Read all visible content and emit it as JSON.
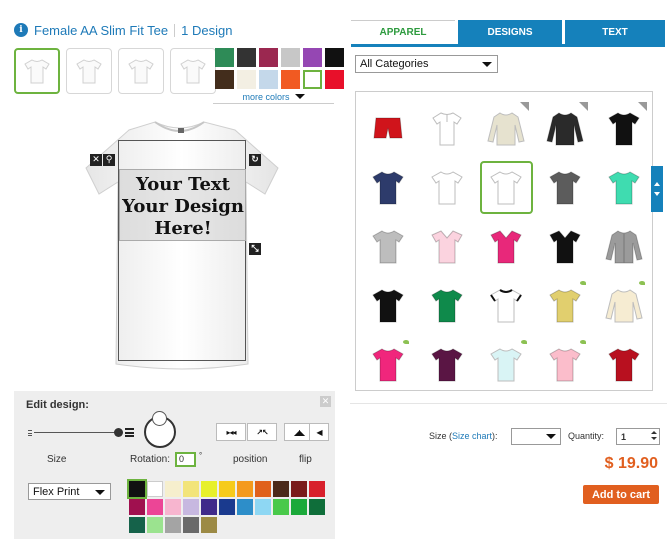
{
  "product": {
    "name": "Female AA Slim Fit Tee",
    "designs": "1 Design",
    "info_icon": "i"
  },
  "views": [
    {
      "name": "front-view",
      "selected": true
    },
    {
      "name": "back-view",
      "selected": false
    },
    {
      "name": "left-view",
      "selected": false
    },
    {
      "name": "right-view",
      "selected": false
    }
  ],
  "shirt_colors": [
    "#2e8b57",
    "#333333",
    "#9b2850",
    "#c7c7c7",
    "#9547b3",
    "#111111",
    "#432d1c",
    "#f3efe3",
    "#c4d8ea",
    "#f15a22",
    "#ffffff",
    "#e8102a"
  ],
  "selected_shirt_color": 10,
  "more_colors_label": "more colors",
  "design_text": "Your Text\nYour Design\nHere!",
  "edit": {
    "title": "Edit design:",
    "close": "✕",
    "size_label": "Size",
    "rotation_label": "Rotation:",
    "rotation_value": "0",
    "degree": "°",
    "position_label": "position",
    "flip_label": "flip",
    "print_type": "Flex Print"
  },
  "print_colors": [
    "#111111",
    "#ffffff",
    "#f6efcd",
    "#f2e47a",
    "#e7f02b",
    "#f6cb1c",
    "#f49a1e",
    "#e0611c",
    "#4b2919",
    "#7a1a1a",
    "#d8202c",
    "#a0104f",
    "#ec4596",
    "#f7b5cf",
    "#c7b8e0",
    "#3f2a8a",
    "#1a3a8e",
    "#2d8ec9",
    "#8ed7f3",
    "#49c94a",
    "#1ba93a",
    "#0f6e3a",
    "#15624a",
    "#9be38f",
    "#a4a4a4",
    "#6a6a6a",
    "#9c8a45"
  ],
  "selected_print_color": 0,
  "tabs": [
    {
      "name": "tab-apparel",
      "label": "APPAREL",
      "active": true
    },
    {
      "name": "tab-designs",
      "label": "DESIGNS",
      "active": false
    },
    {
      "name": "tab-text",
      "label": "TEXT",
      "active": false
    }
  ],
  "category": "All Categories",
  "apparel": [
    {
      "color": "#d0141b",
      "type": "shorts",
      "badge": ""
    },
    {
      "color": "#ffffff",
      "type": "polo",
      "badge": ""
    },
    {
      "color": "#e6e2cf",
      "type": "long",
      "badge": "corner"
    },
    {
      "color": "#2a2a2a",
      "type": "long",
      "badge": "corner"
    },
    {
      "color": "#111111",
      "type": "tee",
      "badge": "corner"
    },
    {
      "color": "#2d3b6b",
      "type": "tee",
      "badge": ""
    },
    {
      "color": "#ffffff",
      "type": "tee",
      "badge": ""
    },
    {
      "color": "#ffffff",
      "type": "tee",
      "badge": "",
      "selected": true
    },
    {
      "color": "#5c5c5c",
      "type": "tee",
      "badge": ""
    },
    {
      "color": "#3fdcb0",
      "type": "tee",
      "badge": ""
    },
    {
      "color": "#bdbdbd",
      "type": "tee",
      "badge": ""
    },
    {
      "color": "#fbd3df",
      "type": "vneck",
      "badge": ""
    },
    {
      "color": "#e8287a",
      "type": "vneck",
      "badge": ""
    },
    {
      "color": "#111111",
      "type": "vneck",
      "badge": ""
    },
    {
      "color": "#9b9b9b",
      "type": "cardigan",
      "badge": ""
    },
    {
      "color": "#111111",
      "type": "tee",
      "badge": ""
    },
    {
      "color": "#0f8a4b",
      "type": "tee",
      "badge": ""
    },
    {
      "color": "#ffffff",
      "type": "ringer",
      "badge": ""
    },
    {
      "color": "#e1cf6e",
      "type": "tee",
      "badge": "leaf"
    },
    {
      "color": "#f6ecd2",
      "type": "long",
      "badge": "leaf"
    },
    {
      "color": "#f0267c",
      "type": "tee",
      "badge": "leaf"
    },
    {
      "color": "#5a1544",
      "type": "tee",
      "badge": ""
    },
    {
      "color": "#d9f4f5",
      "type": "tee",
      "badge": "leaf"
    },
    {
      "color": "#fbbdcb",
      "type": "tee",
      "badge": "leaf"
    },
    {
      "color": "#b8101f",
      "type": "tee",
      "badge": ""
    }
  ],
  "buy": {
    "size_label": "Size (",
    "size_chart_label": "Size chart",
    "size_label_end": "):",
    "quantity_label": "Quantity:",
    "quantity_value": "1",
    "price": "$ 19.90",
    "add_to_cart": "Add to cart"
  }
}
